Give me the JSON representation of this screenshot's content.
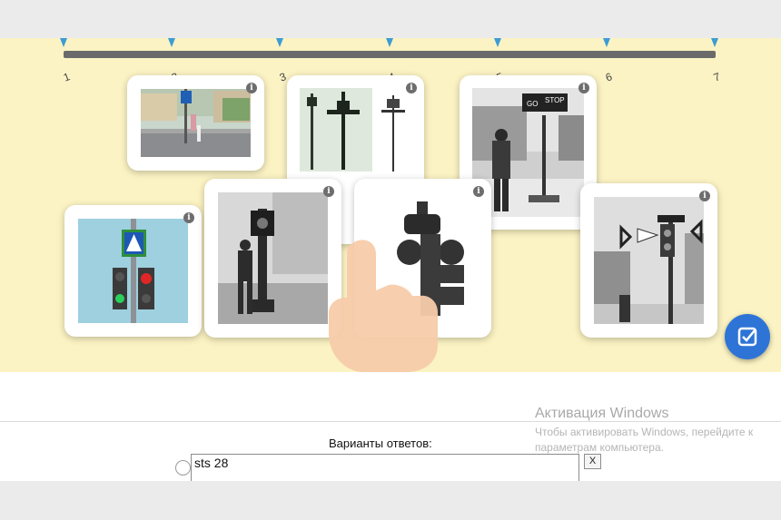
{
  "timeline": {
    "labels": [
      "1",
      "2",
      "3",
      "4",
      "5",
      "6",
      "7"
    ]
  },
  "cards": [
    {
      "id": "card-zebra-crossing",
      "info": "i"
    },
    {
      "id": "card-early-signal-drawings",
      "info": "i"
    },
    {
      "id": "card-go-stop-sign",
      "info": "i"
    },
    {
      "id": "card-pedestrian-light",
      "info": "i"
    },
    {
      "id": "card-tower-signal-policeman",
      "info": "i"
    },
    {
      "id": "card-antique-signal",
      "info": "i"
    },
    {
      "id": "card-street-signal-bw",
      "info": "i"
    }
  ],
  "check_button": {
    "icon": "check-icon"
  },
  "answers": {
    "label": "Варианты ответов:",
    "value": "sts 28",
    "remove": "X"
  },
  "watermark": {
    "title": "Активация Windows",
    "text": "Чтобы активировать Windows, перейдите к параметрам компьютера."
  },
  "colors": {
    "stage_bg": "#fbf3c3",
    "tick": "#3d9cd6",
    "check_button": "#2e74d6"
  }
}
